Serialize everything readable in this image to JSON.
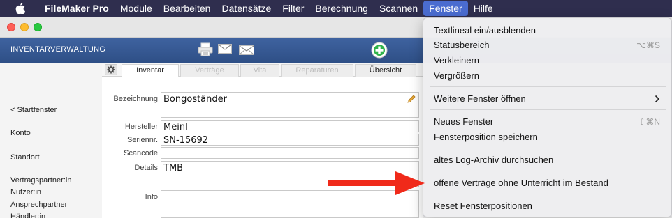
{
  "menubar": {
    "app_name": "FileMaker Pro",
    "items": [
      "Module",
      "Bearbeiten",
      "Datensätze",
      "Filter",
      "Berechnung",
      "Scannen",
      "Fenster",
      "Hilfe"
    ],
    "active_item": "Fenster"
  },
  "header": {
    "title": "INVENTARVERWALTUNG",
    "icons": [
      "printer-icon",
      "mail-icon",
      "mail-open-icon",
      "add-icon"
    ],
    "accent_color": "#3a5c96"
  },
  "sidebar": {
    "items": [
      "< Startfenster",
      "Konto",
      "Standort",
      "Vertragspartner:in",
      "Nutzer:in",
      "Ansprechpartner",
      "Händler:in"
    ]
  },
  "tabs": {
    "items": [
      "Inventar",
      "Verträge",
      "Vita",
      "Reparaturen",
      "Übersicht"
    ],
    "active": "Inventar"
  },
  "form": {
    "bezeichnung_label": "Bezeichnung",
    "bezeichnung_value": "Bongoständer",
    "hersteller_label": "Hersteller",
    "hersteller_value": "Meinl",
    "seriennr_label": "Seriennr.",
    "seriennr_value": "SN-15692",
    "scancode_label": "Scancode",
    "scancode_value": "",
    "details_label": "Details",
    "details_value": "TMB",
    "info_label": "Info",
    "info_value": ""
  },
  "window_menu": {
    "items": [
      {
        "label": "Textlineal ein/ausblenden",
        "shortcut": ""
      },
      {
        "label": "Statusbereich",
        "shortcut": "⌥⌘S"
      },
      {
        "label": "Verkleinern",
        "shortcut": ""
      },
      {
        "label": "Vergrößern",
        "shortcut": ""
      },
      {
        "label": "Weitere Fenster öffnen",
        "shortcut": ""
      },
      {
        "label": "Neues Fenster",
        "shortcut": "⇧⌘N"
      },
      {
        "label": "Fensterposition speichern",
        "shortcut": ""
      },
      {
        "label": "altes Log-Archiv durchsuchen",
        "shortcut": ""
      },
      {
        "label": "offene Verträge ohne Unterricht im Bestand",
        "shortcut": ""
      },
      {
        "label": "Reset Fensterpositionen",
        "shortcut": ""
      }
    ]
  },
  "annotation": {
    "arrow_color": "#f02a1a"
  }
}
